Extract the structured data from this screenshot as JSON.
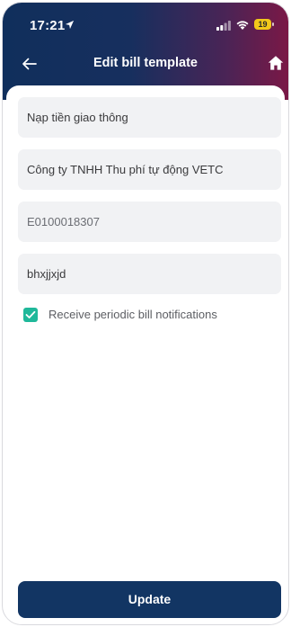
{
  "status_bar": {
    "time": "17:21",
    "battery": "19"
  },
  "header": {
    "title": "Edit bill template"
  },
  "form": {
    "service": "Nạp tiền giao thông",
    "provider": "Công ty TNHH Thu phí tự động VETC",
    "customer_code": "E0100018307",
    "bill_name": "bhxjjxjd"
  },
  "notifications": {
    "label": "Receive periodic bill notifications",
    "checked": true
  },
  "actions": {
    "update_label": "Update"
  },
  "colors": {
    "header_start": "#102f5c",
    "header_end": "#7a1846",
    "accent": "#1fb89a",
    "button": "#123563"
  }
}
